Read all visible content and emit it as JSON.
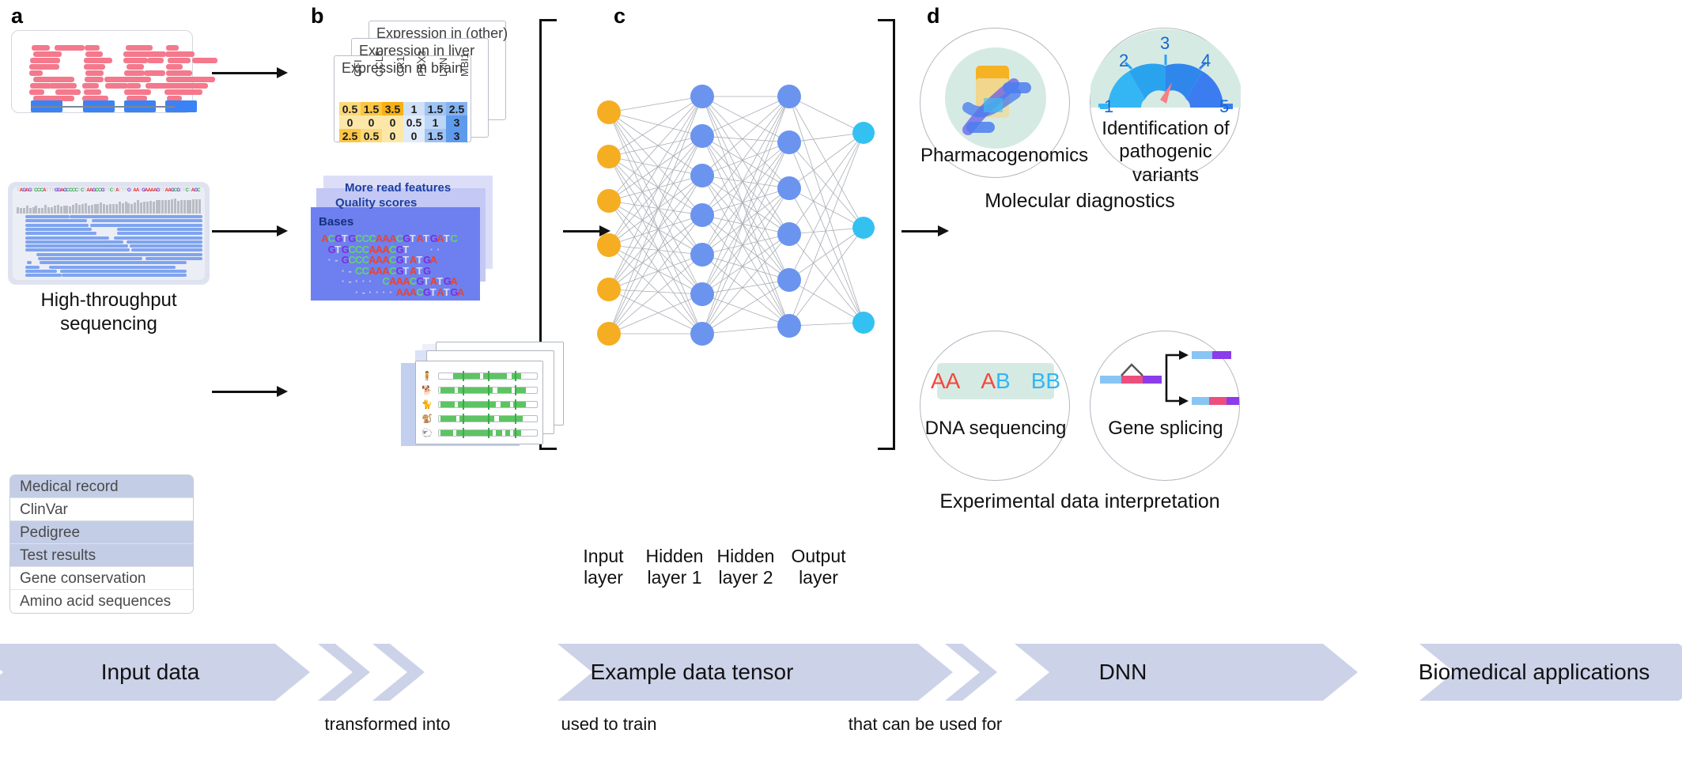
{
  "panels": {
    "a": "a",
    "b": "b",
    "c": "c",
    "d": "d"
  },
  "panel_a": {
    "sequencing_caption_line1": "High-throughput",
    "sequencing_caption_line2": "sequencing",
    "reference_sequence": "TAGAGTCCCATTTGGAGCCCCTCTAAGCCGTTCTATTTGTAATGAAAAGTTAAGCGTTCTAGC",
    "medical_record_rows": [
      {
        "label": "Medical record",
        "shaded": true
      },
      {
        "label": "ClinVar",
        "shaded": false
      },
      {
        "label": "Pedigree",
        "shaded": true
      },
      {
        "label": "Test results",
        "shaded": true
      },
      {
        "label": "Gene conservation",
        "shaded": false
      },
      {
        "label": "Amino acid sequences",
        "shaded": false
      }
    ]
  },
  "panel_b": {
    "expression_cards": [
      {
        "title": "Expression in (other)"
      },
      {
        "title": "Expression in liver"
      },
      {
        "title": "Expression in brain"
      }
    ],
    "expression_table": {
      "genes": [
        "GFI",
        "CCL5",
        "CR1",
        "PBX3",
        "LYN",
        "MBI1"
      ],
      "rows": [
        [
          "0.5",
          "1.5",
          "3.5",
          "1",
          "1.5",
          "2.5"
        ],
        [
          "0",
          "0",
          "0",
          "0.5",
          "1",
          "3"
        ],
        [
          "2.5",
          "0.5",
          "0",
          "0",
          "1.5",
          "3"
        ]
      ],
      "cell_colors": [
        [
          "#fbd97a",
          "#fbc643",
          "#f7b015",
          "#cfe0f7",
          "#9fc3f3",
          "#83b2f0"
        ],
        [
          "#fce7a9",
          "#fce7a9",
          "#fce7a9",
          "#e0ebfa",
          "#bdd6f6",
          "#5f9bec"
        ],
        [
          "#fbc643",
          "#fbd97a",
          "#fce7a9",
          "#e0ebfa",
          "#9fc3f3",
          "#5f9bec"
        ]
      ]
    },
    "read_feature_stack": {
      "layer_more": "More read features",
      "layer_quality": "Quality scores",
      "layer_bases": "Bases",
      "sequences": [
        {
          "indent": 0,
          "text": "ACGTGCCCAAACGTATGATC"
        },
        {
          "indent": 1,
          "text": "GTGCCCAAACGT   ··"
        },
        {
          "indent": 1,
          "text": "·-GCCCAAACGTATGA"
        },
        {
          "indent": 3,
          "text": "·-CCAAACGTATG"
        },
        {
          "indent": 3,
          "text": "·-··· CAAACGTATGA"
        },
        {
          "indent": 5,
          "text": "·-····AAACGTATGA"
        }
      ]
    }
  },
  "panel_c": {
    "layer_labels": [
      {
        "line1": "Input",
        "line2": "layer"
      },
      {
        "line1": "Hidden",
        "line2": "layer 1"
      },
      {
        "line1": "Hidden",
        "line2": "layer 2"
      },
      {
        "line1": "Output",
        "line2": "layer"
      }
    ],
    "node_counts": {
      "input": 6,
      "hidden1": 7,
      "hidden2": 6,
      "output": 3
    },
    "colors": {
      "input": "#f5ae22",
      "hidden": "#6b94ef",
      "output": "#33c1f2",
      "edge": "#a9adb4"
    }
  },
  "panel_d": {
    "top_group_label": "Molecular diagnostics",
    "bottom_group_label": "Experimental data interpretation",
    "circles": [
      {
        "label_line1": "Pharmacogenomics",
        "label_line2": "",
        "label_line3": ""
      },
      {
        "label_line1": "Identification of",
        "label_line2": "pathogenic",
        "label_line3": "variants"
      },
      {
        "label_line1": "DNA sequencing",
        "label_line2": "",
        "label_line3": ""
      },
      {
        "label_line1": "Gene splicing",
        "label_line2": "",
        "label_line3": ""
      }
    ],
    "gauge_ticks": [
      "1",
      "2",
      "3",
      "4",
      "5"
    ],
    "alleles": [
      {
        "text": "AA",
        "color": "#f4473b"
      },
      {
        "text": "AB",
        "color": "#f4473b",
        "color2": "#34b6f5"
      },
      {
        "text": "BB",
        "color": "#34b6f5"
      }
    ],
    "allele_display": [
      "AA",
      "AB",
      "BB"
    ]
  },
  "flow": {
    "steps": [
      "Input data",
      "Example data tensor",
      "DNN",
      "Biomedical applications"
    ],
    "connectors": [
      "transformed into",
      "used to train",
      "that can be used for"
    ],
    "chevron_color": "#ccd2e8"
  }
}
